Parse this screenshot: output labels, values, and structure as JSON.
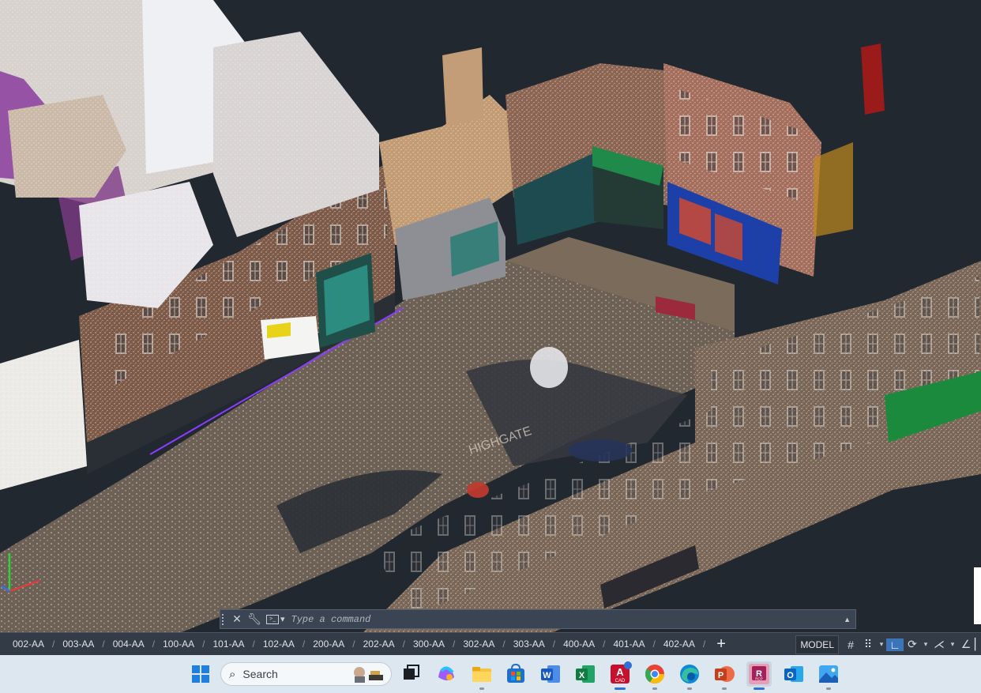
{
  "viewport": {
    "name": "model-space-point-cloud-view",
    "colors": {
      "background": "#212830"
    }
  },
  "command_line": {
    "placeholder": "Type a command",
    "icons": [
      "close-icon",
      "customize-wrench-icon",
      "command-prompt-icon",
      "history-up-icon"
    ]
  },
  "layout_tabs": [
    "002-AA",
    "003-AA",
    "004-AA",
    "100-AA",
    "101-AA",
    "102-AA",
    "200-AA",
    "202-AA",
    "300-AA",
    "302-AA",
    "303-AA",
    "400-AA",
    "401-AA",
    "402-AA"
  ],
  "add_tab_label": "+",
  "status_bar": {
    "model_label": "MODEL",
    "icons": [
      "grid-icon",
      "snap-icon",
      "ortho-icon",
      "polar-icon",
      "isodraft-icon",
      "angle-icon"
    ]
  },
  "taskbar": {
    "search_label": "Search",
    "apps": [
      {
        "name": "task-view",
        "icon": "task-view-icon"
      },
      {
        "name": "copilot",
        "icon": "copilot-icon"
      },
      {
        "name": "file-explorer",
        "icon": "folder-icon"
      },
      {
        "name": "microsoft-store",
        "icon": "store-icon"
      },
      {
        "name": "word",
        "icon": "word-icon",
        "letter": "W"
      },
      {
        "name": "excel",
        "icon": "excel-icon",
        "letter": "X"
      },
      {
        "name": "autocad",
        "icon": "autocad-icon",
        "letter": "A",
        "badge": "CAD"
      },
      {
        "name": "chrome",
        "icon": "chrome-icon"
      },
      {
        "name": "edge",
        "icon": "edge-icon"
      },
      {
        "name": "powerpoint",
        "icon": "powerpoint-icon",
        "letter": "P"
      },
      {
        "name": "recap",
        "icon": "recap-icon",
        "letter": "R",
        "badge": "RCP"
      },
      {
        "name": "outlook",
        "icon": "outlook-icon",
        "letter": "O"
      },
      {
        "name": "photos",
        "icon": "photos-icon"
      }
    ]
  }
}
